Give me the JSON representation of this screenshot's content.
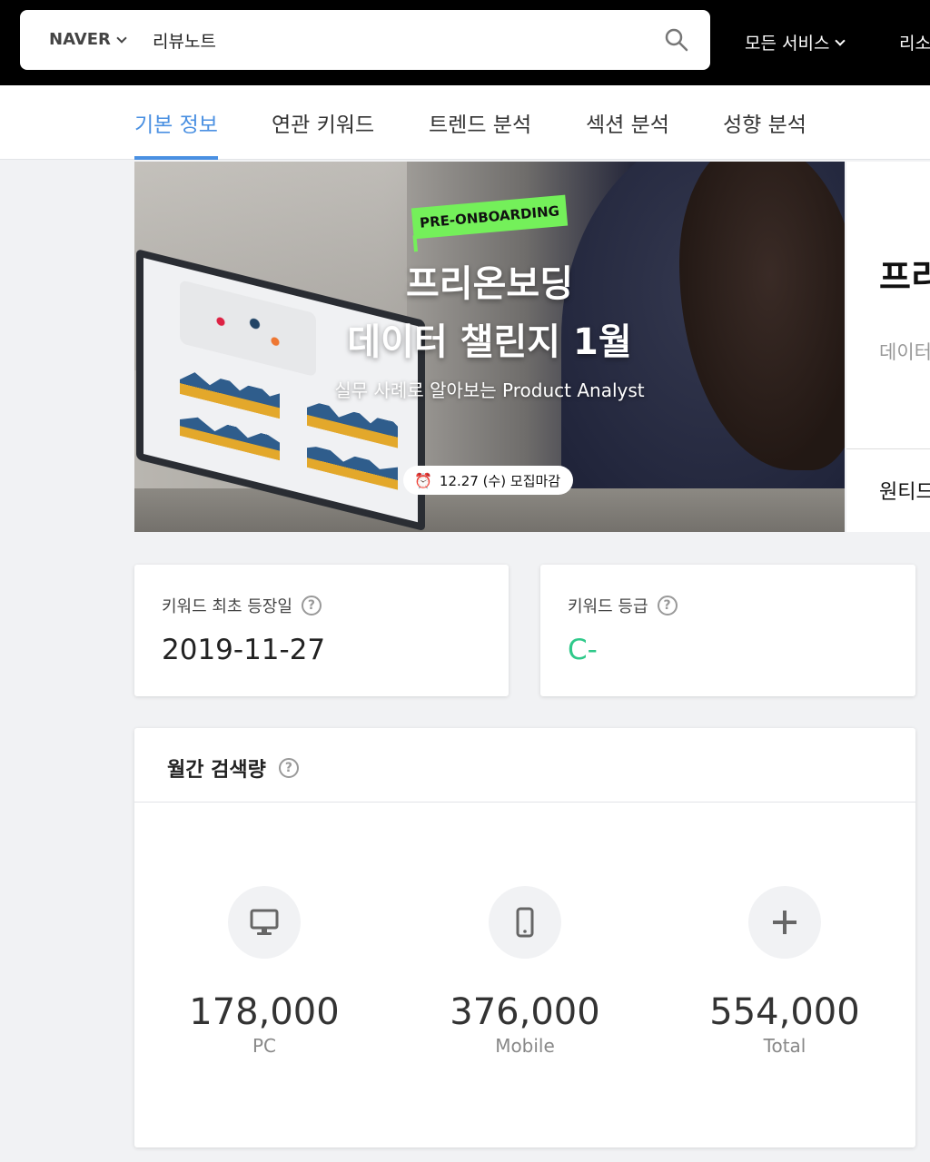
{
  "header": {
    "engine": "NAVER",
    "query": "리뷰노트",
    "all_services": "모든 서비스",
    "extra_menu": "리소"
  },
  "tabs": [
    {
      "label": "기본 정보",
      "active": true
    },
    {
      "label": "연관 키워드",
      "active": false
    },
    {
      "label": "트렌드 분석",
      "active": false
    },
    {
      "label": "섹션 분석",
      "active": false
    },
    {
      "label": "성향 분석",
      "active": false
    }
  ],
  "banner": {
    "tag": "PRE-ONBOARDING",
    "title_line1": "프리온보딩",
    "title_line2": "데이터 챌린지 1월",
    "subtitle": "실무 사례로 알아보는 Product Analyst",
    "deadline": "12.27 (수) 모집마감",
    "tag_color": "#74f05a"
  },
  "side_panel": {
    "title": "프리",
    "desc": "데이터",
    "footer": "원티드"
  },
  "keyword_first_seen": {
    "label": "키워드 최초 등장일",
    "value": "2019-11-27"
  },
  "keyword_grade": {
    "label": "키워드 등급",
    "value": "C-",
    "color": "#2fc98a"
  },
  "monthly_search": {
    "title": "월간 검색량",
    "stats": [
      {
        "icon": "desktop-icon",
        "value": "178,000",
        "label": "PC"
      },
      {
        "icon": "mobile-icon",
        "value": "376,000",
        "label": "Mobile"
      },
      {
        "icon": "plus-icon",
        "value": "554,000",
        "label": "Total"
      }
    ]
  },
  "colors": {
    "accent": "#4a90e2",
    "topbar": "#000000"
  }
}
